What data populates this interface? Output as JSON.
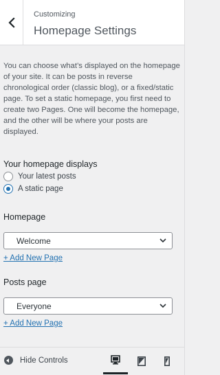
{
  "header": {
    "breadcrumb": "Customizing",
    "title": "Homepage Settings",
    "back_icon": "chevron-left-icon"
  },
  "description": "You can choose what’s displayed on the homepage of your site. It can be posts in reverse chronological order (classic blog), or a fixed/static page. To set a static homepage, you first need to create two Pages. One will become the homepage, and the other will be where your posts are displayed.",
  "homepage_displays": {
    "label": "Your homepage displays",
    "options": [
      {
        "label": "Your latest posts",
        "checked": false
      },
      {
        "label": "A static page",
        "checked": true
      }
    ]
  },
  "homepage": {
    "label": "Homepage",
    "selected": "Welcome",
    "add_link": "+ Add New Page"
  },
  "posts_page": {
    "label": "Posts page",
    "selected": "Everyone",
    "add_link": "+ Add New Page"
  },
  "footer": {
    "hide_controls": "Hide Controls",
    "devices": [
      {
        "name": "desktop",
        "icon": "desktop-icon",
        "active": true
      },
      {
        "name": "tablet",
        "icon": "tablet-icon",
        "active": false
      },
      {
        "name": "mobile",
        "icon": "mobile-icon",
        "active": false
      }
    ]
  },
  "colors": {
    "link": "#2271b1",
    "text": "#3c434a",
    "background": "#f0f0f1"
  }
}
